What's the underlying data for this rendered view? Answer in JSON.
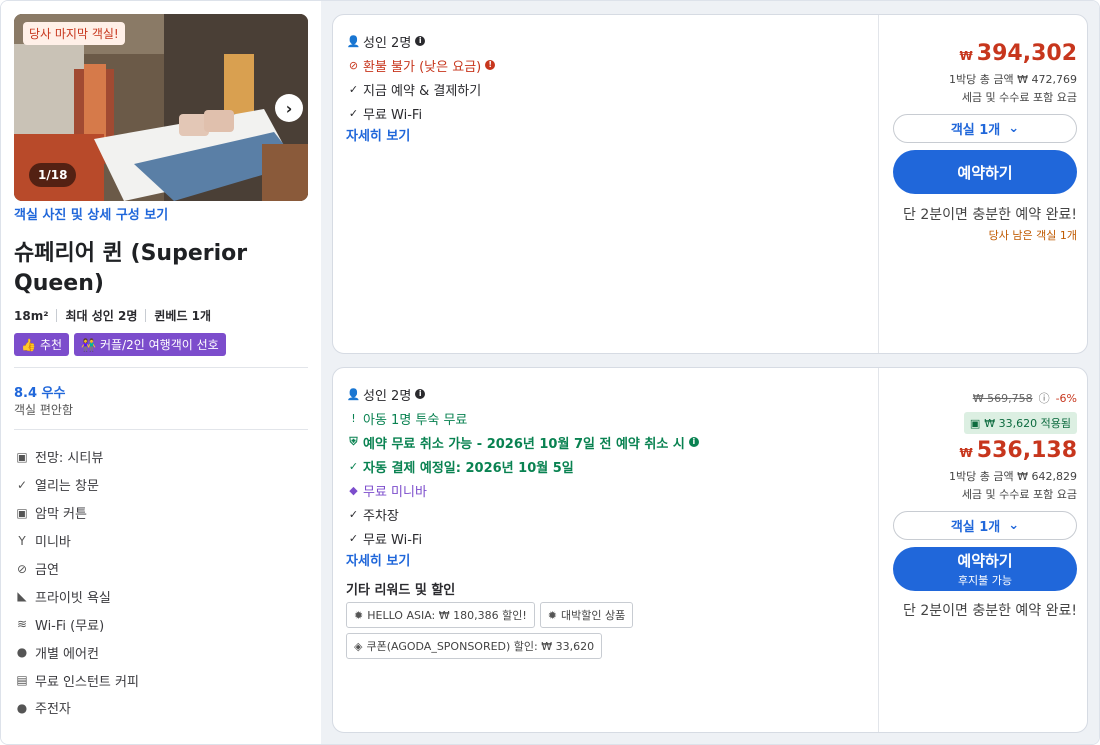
{
  "room": {
    "photo_badge": "당사 마지막 객실!",
    "photo_counter": "1/18",
    "photo_link": "객실 사진 및 상세 구성 보기",
    "title": "슈페리어 퀸 (Superior Queen)",
    "specs": [
      "18m²",
      "최대 성인 2명",
      "퀸베드 1개"
    ],
    "tags": [
      {
        "icon": "thumbs-up-icon",
        "label": "추천"
      },
      {
        "icon": "couple-icon",
        "label": "커플/2인 여행객이 선호"
      }
    ],
    "rating": "8.4 우수",
    "rating_sub": "객실 편안함",
    "amenities": [
      {
        "icon": "view-icon",
        "label": "전망: 시티뷰"
      },
      {
        "icon": "check-icon",
        "label": "열리는 창문"
      },
      {
        "icon": "blackout-icon",
        "label": "암막 커튼"
      },
      {
        "icon": "cocktail-icon",
        "label": "미니바"
      },
      {
        "icon": "no-smoking-icon",
        "label": "금연"
      },
      {
        "icon": "bath-icon",
        "label": "프라이빗 욕실"
      },
      {
        "icon": "wifi-icon",
        "label": "Wi-Fi (무료)"
      },
      {
        "icon": "check-circle-icon",
        "label": "개별 에어컨"
      },
      {
        "icon": "coffee-icon",
        "label": "무료 인스턴트 커피"
      },
      {
        "icon": "check-circle-icon",
        "label": "주전자"
      }
    ]
  },
  "offers": [
    {
      "features": {
        "adults": "성인 2명",
        "refund": "환불 불가 (낮은 요금)",
        "pay": "지금 예약 & 결제하기",
        "wifi": "무료 Wi-Fi"
      },
      "details_link": "자세히 보기",
      "currency": "₩",
      "price": "394,302",
      "per_night": "1박당 총 금액 ₩ 472,769",
      "tax_note": "세금 및 수수료 포함 요금",
      "qty_label": "객실 1개",
      "book_label": "예약하기",
      "quick_note": "단 2분이면 충분한 예약 완료!",
      "last_room": "당사 남은 객실 1개"
    },
    {
      "features": {
        "adults": "성인 2명",
        "child": "아동 1명 투숙 무료",
        "cancel": "예약 무료 취소 가능 - 2026년 10월 7일 전 예약 취소 시",
        "autopay": "자동 결제 예정일: 2026년 10월 5일",
        "minibar": "무료 미니바",
        "parking": "주차장",
        "wifi": "무료 Wi-Fi"
      },
      "details_link": "자세히 보기",
      "promo_title": "기타 리워드 및 할인",
      "promos": [
        "HELLO ASIA: ₩ 180,386 할인!",
        "대박할인 상품",
        "쿠폰(AGODA_SPONSORED) 할인: ₩ 33,620"
      ],
      "original_price": "₩ 569,758",
      "discount_pct": "-6%",
      "applied": "₩ 33,620 적용됨",
      "currency": "₩",
      "price": "536,138",
      "per_night": "1박당 총 금액 ₩ 642,829",
      "tax_note": "세금 및 수수료 포함 요금",
      "qty_label": "객실 1개",
      "book_label": "예약하기",
      "book_sub": "후지불 가능",
      "quick_note": "단 2분이면 충분한 예약 완료!"
    }
  ],
  "colors": {
    "brand_blue": "#2067da",
    "price_red": "#c7361d",
    "green": "#098251",
    "purple": "#7c4dcc"
  }
}
